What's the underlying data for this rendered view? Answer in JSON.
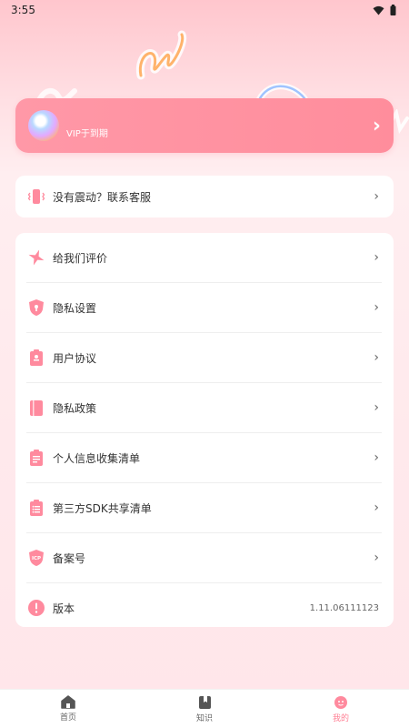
{
  "status_bar": {
    "time": "3:55"
  },
  "vip": {
    "text": "VIP于到期",
    "arrow": "›"
  },
  "support": {
    "label": "没有震动？联系客服"
  },
  "menu": [
    {
      "label": "给我们评价",
      "icon": "sparkle-icon"
    },
    {
      "label": "隐私设置",
      "icon": "shield-lock-icon"
    },
    {
      "label": "用户协议",
      "icon": "document-icon"
    },
    {
      "label": "隐私政策",
      "icon": "notebook-icon"
    },
    {
      "label": "个人信息收集清单",
      "icon": "clipboard-icon"
    },
    {
      "label": "第三方SDK共享清单",
      "icon": "clipboard-list-icon"
    },
    {
      "label": "备案号",
      "icon": "icp-badge-icon"
    },
    {
      "label": "版本",
      "value": "1.11.06111123",
      "icon": "exclamation-icon"
    }
  ],
  "icp_badge_text": "ICP",
  "tabs": [
    {
      "label": "首页",
      "icon": "home-icon"
    },
    {
      "label": "知识",
      "icon": "book-icon"
    },
    {
      "label": "我的",
      "icon": "profile-icon"
    }
  ],
  "colors": {
    "accent": "#ff7e93",
    "card_pink": "#ff95a4"
  }
}
